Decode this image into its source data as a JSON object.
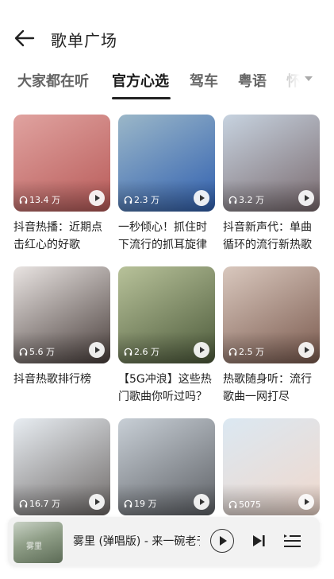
{
  "header": {
    "title": "歌单广场"
  },
  "tabs": [
    {
      "label": "大家都在听",
      "active": false
    },
    {
      "label": "官方心选",
      "active": true
    },
    {
      "label": "驾车",
      "active": false
    },
    {
      "label": "粤语",
      "active": false
    },
    {
      "label": "怀",
      "active": false
    }
  ],
  "playlists": [
    {
      "title": "抖音热播：近期点击红心的好歌",
      "plays": "13.4 万",
      "cover_colors": [
        "#e0a3a0",
        "#b85a58"
      ]
    },
    {
      "title": "一秒倾心！抓住时下流行的抓耳旋律",
      "plays": "2.3 万",
      "cover_colors": [
        "#9bb7c8",
        "#3060b0"
      ]
    },
    {
      "title": "抖音新声代：单曲循环的流行新热歌",
      "plays": "3.2 万",
      "cover_colors": [
        "#c7d3e0",
        "#7a6a6e"
      ]
    },
    {
      "title": "抖音热歌排行榜",
      "plays": "5.6 万",
      "cover_colors": [
        "#e9e4e2",
        "#4a3f3c"
      ]
    },
    {
      "title": "【5G冲浪】这些热门歌曲你听过吗？",
      "plays": "2.6 万",
      "cover_colors": [
        "#b8c29a",
        "#4c5a3a"
      ]
    },
    {
      "title": "热歌随身听：流行歌曲一网打尽",
      "plays": "2.5 万",
      "cover_colors": [
        "#d9c8be",
        "#7b5a4e"
      ]
    },
    {
      "title": "",
      "plays": "16.7 万",
      "cover_colors": [
        "#e8edf2",
        "#6f6a68"
      ]
    },
    {
      "title": "",
      "plays": "19 万",
      "cover_colors": [
        "#c8cfd6",
        "#5e6166"
      ]
    },
    {
      "title": "",
      "plays": "5075",
      "cover_colors": [
        "#dbe8f2",
        "#f0d8cc"
      ]
    }
  ],
  "mini_player": {
    "title": "雾里 (弹唱版) - 来一碗老于",
    "cover_text": "雾里"
  }
}
